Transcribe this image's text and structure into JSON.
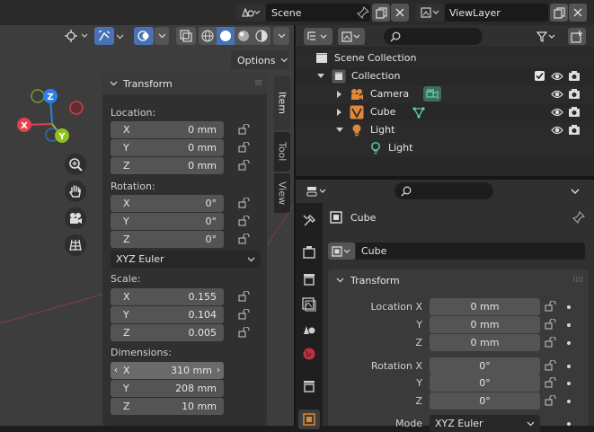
{
  "topbar": {
    "scene_label": "Scene",
    "viewlayer_label": "ViewLayer"
  },
  "viewport": {
    "options_label": "Options",
    "side_tabs": [
      "Item",
      "Tool",
      "View"
    ],
    "gizmo": {
      "z": "Z",
      "y": "Y",
      "x": "X"
    }
  },
  "npanel": {
    "header": "Transform",
    "location_label": "Location:",
    "location": [
      {
        "axis": "X",
        "value": "0 mm"
      },
      {
        "axis": "Y",
        "value": "0 mm"
      },
      {
        "axis": "Z",
        "value": "0 mm"
      }
    ],
    "rotation_label": "Rotation:",
    "rotation": [
      {
        "axis": "X",
        "value": "0°"
      },
      {
        "axis": "Y",
        "value": "0°"
      },
      {
        "axis": "Z",
        "value": "0°"
      }
    ],
    "rotation_mode": "XYZ Euler",
    "scale_label": "Scale:",
    "scale": [
      {
        "axis": "X",
        "value": "0.155"
      },
      {
        "axis": "Y",
        "value": "0.104"
      },
      {
        "axis": "Z",
        "value": "0.005"
      }
    ],
    "dimensions_label": "Dimensions:",
    "dimensions": [
      {
        "axis": "X",
        "value": "310 mm"
      },
      {
        "axis": "Y",
        "value": "208 mm"
      },
      {
        "axis": "Z",
        "value": "10 mm"
      }
    ]
  },
  "outliner": {
    "scene_collection": "Scene Collection",
    "collection": "Collection",
    "items": [
      {
        "label": "Camera"
      },
      {
        "label": "Cube"
      },
      {
        "label": "Light"
      }
    ],
    "light_data": "Light"
  },
  "properties": {
    "object_name": "Cube",
    "data_name": "Cube",
    "panel_header": "Transform",
    "location_label": "Location X",
    "rotation_label": "Rotation X",
    "y_label": "Y",
    "z_label": "Z",
    "location": [
      "0 mm",
      "0 mm",
      "0 mm"
    ],
    "rotation": [
      "0°",
      "0°",
      "0°"
    ],
    "mode_label": "Mode",
    "mode_value": "XYZ Euler"
  },
  "colors": {
    "accent_blue": "#4772b3",
    "axis_x": "#e54150",
    "axis_y": "#8ec21e",
    "axis_z": "#2d80e6",
    "object_orange": "#e0873a",
    "data_green": "#5fd3a0"
  }
}
